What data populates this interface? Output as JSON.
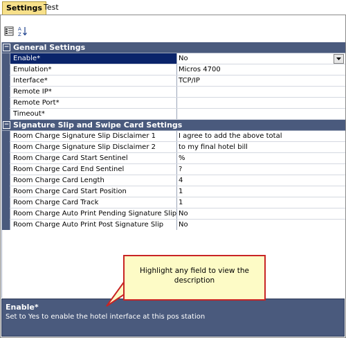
{
  "tabs": [
    {
      "label": "Settings",
      "active": true
    },
    {
      "label": "Test",
      "active": false
    }
  ],
  "toolbar": {
    "categorized_icon": "categorized-icon",
    "alphabetical_icon": "sort-az-icon"
  },
  "categories": [
    {
      "title": "General Settings",
      "rows": [
        {
          "name": "Enable*",
          "value": "No",
          "selected": true,
          "dropdown": true
        },
        {
          "name": "Emulation*",
          "value": "Micros 4700"
        },
        {
          "name": "Interface*",
          "value": "TCP/IP"
        },
        {
          "name": "Remote IP*",
          "value": ""
        },
        {
          "name": "Remote Port*",
          "value": ""
        },
        {
          "name": "Timeout*",
          "value": ""
        }
      ]
    },
    {
      "title": "Signature Slip and Swipe Card Settings",
      "rows": [
        {
          "name": "Room Charge Signature Slip Disclaimer 1",
          "value": "I agree to add the above total"
        },
        {
          "name": "Room Charge Signature Slip Disclaimer 2",
          "value": "to my final hotel bill"
        },
        {
          "name": "Room Charge Card Start Sentinel",
          "value": "%"
        },
        {
          "name": "Room Charge Card End Sentinel",
          "value": "?"
        },
        {
          "name": "Room Charge Card Length",
          "value": "4"
        },
        {
          "name": "Room Charge Card Start Position",
          "value": "1"
        },
        {
          "name": "Room Charge Card Track",
          "value": "1"
        },
        {
          "name": "Room Charge Auto Print Pending Signature Slip",
          "value": "No"
        },
        {
          "name": "Room Charge Auto Print Post Signature Slip",
          "value": "No"
        }
      ]
    }
  ],
  "callout": {
    "text": "Highlight any field to view the description"
  },
  "description": {
    "title": "Enable*",
    "text": "Set to Yes to enable the hotel interface at this pos station"
  },
  "colors": {
    "category_bg": "#4a5a7d",
    "selected_bg": "#0a246a",
    "tab_active_bg": "#f7e08a",
    "callout_bg": "#fdfbc6",
    "callout_border": "#c82424"
  }
}
